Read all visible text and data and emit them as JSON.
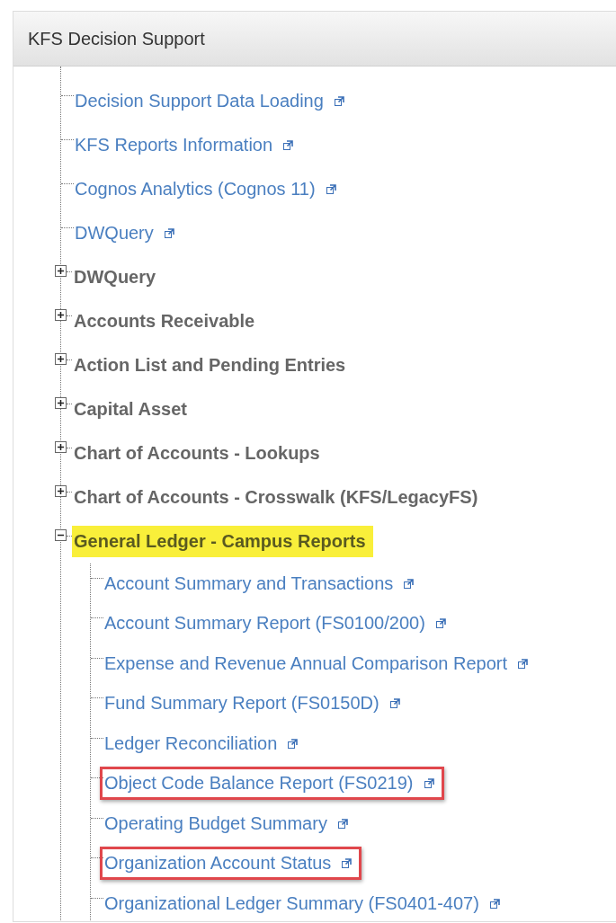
{
  "panel": {
    "title": "KFS Decision Support",
    "tree": [
      {
        "kind": "link",
        "label": "Decision Support Data Loading",
        "boxed": false
      },
      {
        "kind": "link",
        "label": "KFS Reports Information",
        "boxed": false
      },
      {
        "kind": "link",
        "label": "Cognos Analytics (Cognos 11)",
        "boxed": false
      },
      {
        "kind": "link",
        "label": "DWQuery",
        "boxed": false
      },
      {
        "kind": "folder",
        "label": "DWQuery",
        "expanded": false,
        "highlighted": false
      },
      {
        "kind": "folder",
        "label": "Accounts Receivable",
        "expanded": false,
        "highlighted": false
      },
      {
        "kind": "folder",
        "label": "Action List and Pending Entries",
        "expanded": false,
        "highlighted": false
      },
      {
        "kind": "folder",
        "label": "Capital Asset",
        "expanded": false,
        "highlighted": false
      },
      {
        "kind": "folder",
        "label": "Chart of Accounts - Lookups",
        "expanded": false,
        "highlighted": false
      },
      {
        "kind": "folder",
        "label": "Chart of Accounts - Crosswalk (KFS/LegacyFS)",
        "expanded": false,
        "highlighted": false
      },
      {
        "kind": "folder",
        "label": "General Ledger - Campus Reports",
        "expanded": true,
        "highlighted": true,
        "children": [
          {
            "kind": "link",
            "label": "Account Summary and Transactions",
            "boxed": false
          },
          {
            "kind": "link",
            "label": "Account Summary Report (FS0100/200)",
            "boxed": false
          },
          {
            "kind": "link",
            "label": "Expense and Revenue Annual Comparison Report",
            "boxed": false
          },
          {
            "kind": "link",
            "label": "Fund Summary Report (FS0150D)",
            "boxed": false
          },
          {
            "kind": "link",
            "label": "Ledger Reconciliation",
            "boxed": false
          },
          {
            "kind": "link",
            "label": "Object Code Balance Report (FS0219)",
            "boxed": true
          },
          {
            "kind": "link",
            "label": "Operating Budget Summary",
            "boxed": false
          },
          {
            "kind": "link",
            "label": "Organization Account Status",
            "boxed": true
          },
          {
            "kind": "link",
            "label": "Organizational Ledger Summary (FS0401-407)",
            "boxed": false
          }
        ]
      }
    ]
  }
}
